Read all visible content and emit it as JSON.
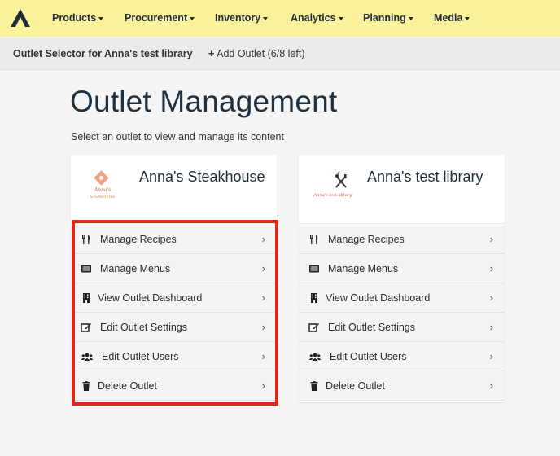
{
  "nav": {
    "items": [
      {
        "label": "Products"
      },
      {
        "label": "Procurement"
      },
      {
        "label": "Inventory"
      },
      {
        "label": "Analytics"
      },
      {
        "label": "Planning"
      },
      {
        "label": "Media"
      }
    ]
  },
  "subbar": {
    "title": "Outlet Selector for Anna's test library",
    "add_outlet": "Add Outlet (6/8 left)"
  },
  "page": {
    "title": "Outlet Management",
    "subtitle": "Select an outlet to view and manage its content"
  },
  "outlets": [
    {
      "name": "Anna's Steakhouse",
      "logo_text": "Anna's",
      "logo_subtext": "STEAKHOUSE",
      "actions": [
        {
          "label": "Manage Recipes",
          "icon": "utensils-icon"
        },
        {
          "label": "Manage Menus",
          "icon": "list-card-icon"
        },
        {
          "label": "View Outlet Dashboard",
          "icon": "building-icon"
        },
        {
          "label": "Edit Outlet Settings",
          "icon": "edit-icon"
        },
        {
          "label": "Edit Outlet Users",
          "icon": "users-icon"
        },
        {
          "label": "Delete Outlet",
          "icon": "trash-icon"
        }
      ]
    },
    {
      "name": "Anna's test library",
      "logo_text": "Anna's test library",
      "actions": [
        {
          "label": "Manage Recipes",
          "icon": "utensils-icon"
        },
        {
          "label": "Manage Menus",
          "icon": "list-card-icon"
        },
        {
          "label": "View Outlet Dashboard",
          "icon": "building-icon"
        },
        {
          "label": "Edit Outlet Settings",
          "icon": "edit-icon"
        },
        {
          "label": "Edit Outlet Users",
          "icon": "users-icon"
        },
        {
          "label": "Delete Outlet",
          "icon": "trash-icon"
        }
      ]
    }
  ],
  "chevron": "›",
  "colors": {
    "nav_background": "#fdf29c",
    "highlight_border": "#d92a1c",
    "text_dark": "#1f2d3a"
  }
}
